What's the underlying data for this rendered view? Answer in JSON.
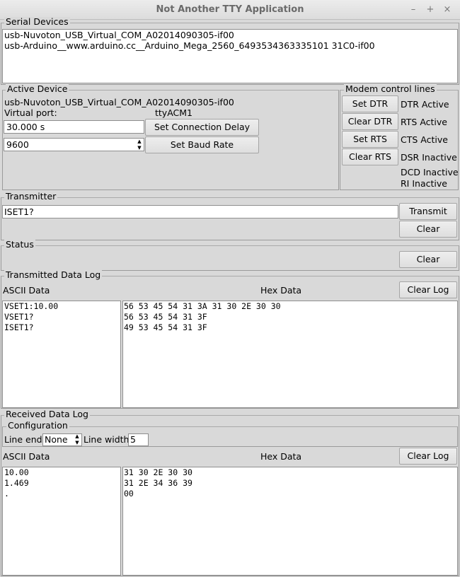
{
  "window": {
    "title": "Not Another TTY Application",
    "minimize_icon": "–",
    "maximize_icon": "+",
    "close_icon": "×"
  },
  "serial_devices": {
    "label": "Serial Devices",
    "items": [
      "usb-Nuvoton_USB_Virtual_COM_A02014090305-if00",
      "usb-Arduino__www.arduino.cc__Arduino_Mega_2560_6493534363335101 31C0-if00"
    ]
  },
  "active_device": {
    "label": "Active Device",
    "device_name": "usb-Nuvoton_USB_Virtual_COM_A02014090305-if00",
    "virtual_port_label": "Virtual port:",
    "virtual_port_value": "ttyACM1",
    "delay_value": "30.000 s",
    "set_delay_label": "Set Connection Delay",
    "baud_value": "9600",
    "set_baud_label": "Set Baud Rate"
  },
  "modem": {
    "label": "Modem control lines",
    "set_dtr": "Set DTR",
    "clear_dtr": "Clear DTR",
    "set_rts": "Set RTS",
    "clear_rts": "Clear RTS",
    "dtr_status": "DTR Active",
    "rts_status": "RTS Active",
    "cts_status": "CTS Active",
    "dsr_status": "DSR Inactive",
    "dcd_status": "DCD Inactive",
    "ri_status": "RI Inactive"
  },
  "transmitter": {
    "label": "Transmitter",
    "input_value": "ISET1?",
    "transmit_label": "Transmit",
    "clear_label": "Clear"
  },
  "status": {
    "label": "Status",
    "clear_label": "Clear"
  },
  "tx_log": {
    "label": "Transmitted Data Log",
    "ascii_header": "ASCII Data",
    "hex_header": "Hex Data",
    "clear_label": "Clear Log",
    "ascii_lines": [
      "VSET1:10.00",
      "VSET1?",
      "ISET1?"
    ],
    "hex_lines": [
      "56 53 45 54 31 3A 31 30 2E 30 30",
      "56 53 45 54 31 3F",
      "49 53 45 54 31 3F"
    ]
  },
  "rx_log": {
    "label": "Received Data Log",
    "config_label": "Configuration",
    "line_end_label": "Line end",
    "line_end_value": "None",
    "line_width_label": "Line width",
    "line_width_value": "5",
    "ascii_header": "ASCII Data",
    "hex_header": "Hex Data",
    "clear_label": "Clear Log",
    "ascii_lines": [
      "10.00",
      "1.469",
      "."
    ],
    "hex_lines": [
      "31 30 2E 30 30",
      "31 2E 34 36 39",
      "00"
    ]
  }
}
